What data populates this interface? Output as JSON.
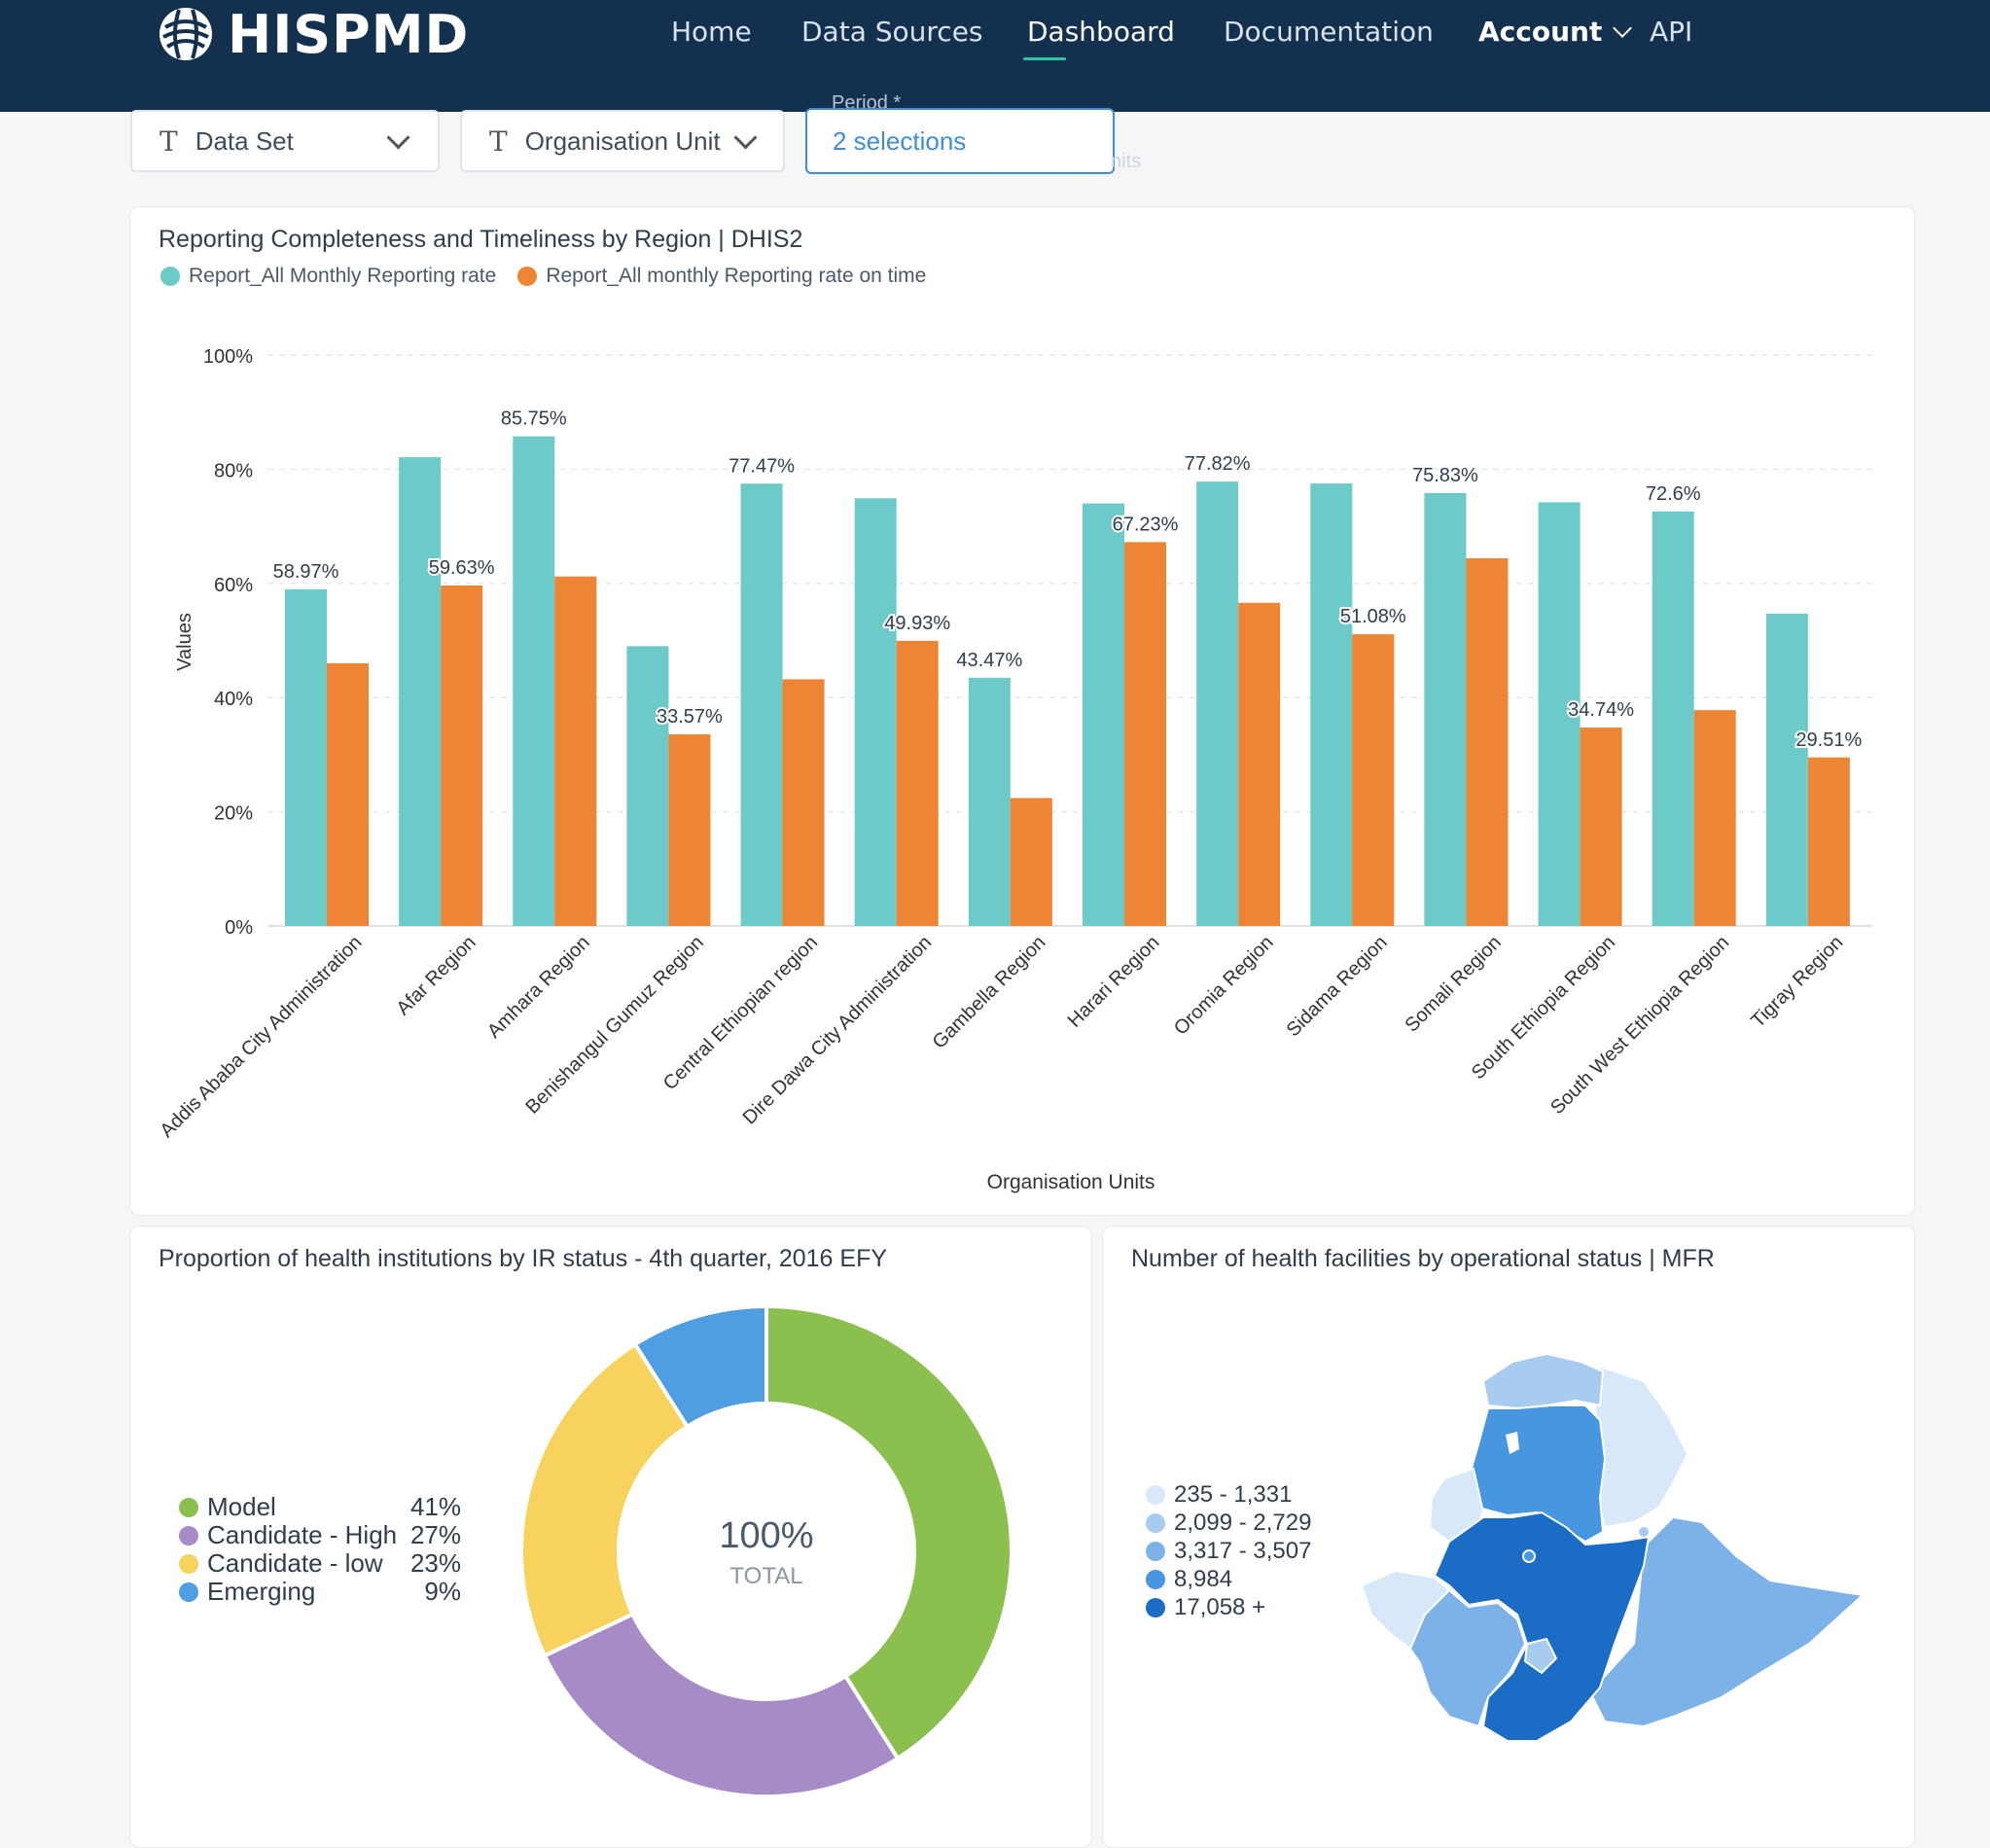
{
  "nav": {
    "brand": "HISPMD",
    "items": [
      "Home",
      "Data Sources",
      "Dashboard",
      "Documentation"
    ],
    "account_label": "Account",
    "api_label": "API",
    "active": "Dashboard"
  },
  "filters": {
    "data_set": "Data Set",
    "org_unit": "Organisation Unit",
    "period_label": "Period *",
    "period_value": "2 selections",
    "ghost_text": "nits"
  },
  "bar_card": {
    "title": "Reporting Completeness and Timeliness by Region | DHIS2",
    "legend": [
      "Report_All Monthly Reporting rate",
      "Report_All monthly Reporting rate on time"
    ]
  },
  "chart_data": [
    {
      "type": "bar",
      "title": "Reporting Completeness and Timeliness by Region | DHIS2",
      "xlabel": "Organisation Units",
      "ylabel": "Values",
      "ylim": [
        0,
        100
      ],
      "yticks": [
        "0%",
        "20%",
        "40%",
        "60%",
        "80%",
        "100%"
      ],
      "grid": true,
      "legend_position": "top-left",
      "categories": [
        "Addis Ababa City Administration",
        "Afar Region",
        "Amhara Region",
        "Benishangul Gumuz Region",
        "Central Ethiopian region",
        "Dire Dawa City Administration",
        "Gambella Region",
        "Harari Region",
        "Oromia Region",
        "Sidama Region",
        "Somali Region",
        "South Ethiopia Region",
        "South West Ethiopia Region",
        "Tigray Region"
      ],
      "series": [
        {
          "name": "Report_All Monthly Reporting rate",
          "color": "#6ccac8",
          "values": [
            58.97,
            82.1,
            85.75,
            49.0,
            77.47,
            74.9,
            43.47,
            74.0,
            77.82,
            77.5,
            75.83,
            74.2,
            72.6,
            54.7
          ],
          "labels": [
            "58.97%",
            "",
            "85.75%",
            "",
            "77.47%",
            "",
            "43.47%",
            "",
            "77.82%",
            "",
            "75.83%",
            "",
            "72.6%",
            ""
          ]
        },
        {
          "name": "Report_All monthly Reporting rate on time",
          "color": "#ee8534",
          "values": [
            46.0,
            59.63,
            61.2,
            33.57,
            43.2,
            49.93,
            22.4,
            67.23,
            56.6,
            51.08,
            64.4,
            34.74,
            37.8,
            29.51
          ],
          "labels": [
            "",
            "59.63%",
            "",
            "33.57%",
            "",
            "49.93%",
            "",
            "67.23%",
            "",
            "51.08%",
            "",
            "34.74%",
            "",
            "29.51%"
          ]
        }
      ]
    },
    {
      "type": "pie",
      "title": "Proportion of health institutions by IR status - 4th quarter, 2016 EFY",
      "center_value": "100%",
      "center_label": "TOTAL",
      "categories": [
        "Model",
        "Candidate - High",
        "Candidate - low",
        "Emerging"
      ],
      "values": [
        41,
        27,
        23,
        9
      ],
      "labels": [
        "41%",
        "27%",
        "23%",
        "9%"
      ],
      "colors": [
        "#8bc04f",
        "#a78bc7",
        "#f7d25c",
        "#4f9de2"
      ]
    }
  ],
  "donut_card": {
    "title": "Proportion of health institutions by IR status - 4th quarter, 2016 EFY"
  },
  "map_card": {
    "title": "Number of health facilities by operational status | MFR",
    "legend": [
      {
        "label": "235 - 1,331",
        "color": "#d7e8f8"
      },
      {
        "label": "2,099 - 2,729",
        "color": "#a8cbf0"
      },
      {
        "label": "3,317 - 3,507",
        "color": "#7db2e8"
      },
      {
        "label": "8,984",
        "color": "#4796e0"
      },
      {
        "label": "17,058 +",
        "color": "#1a6cc4"
      }
    ]
  }
}
